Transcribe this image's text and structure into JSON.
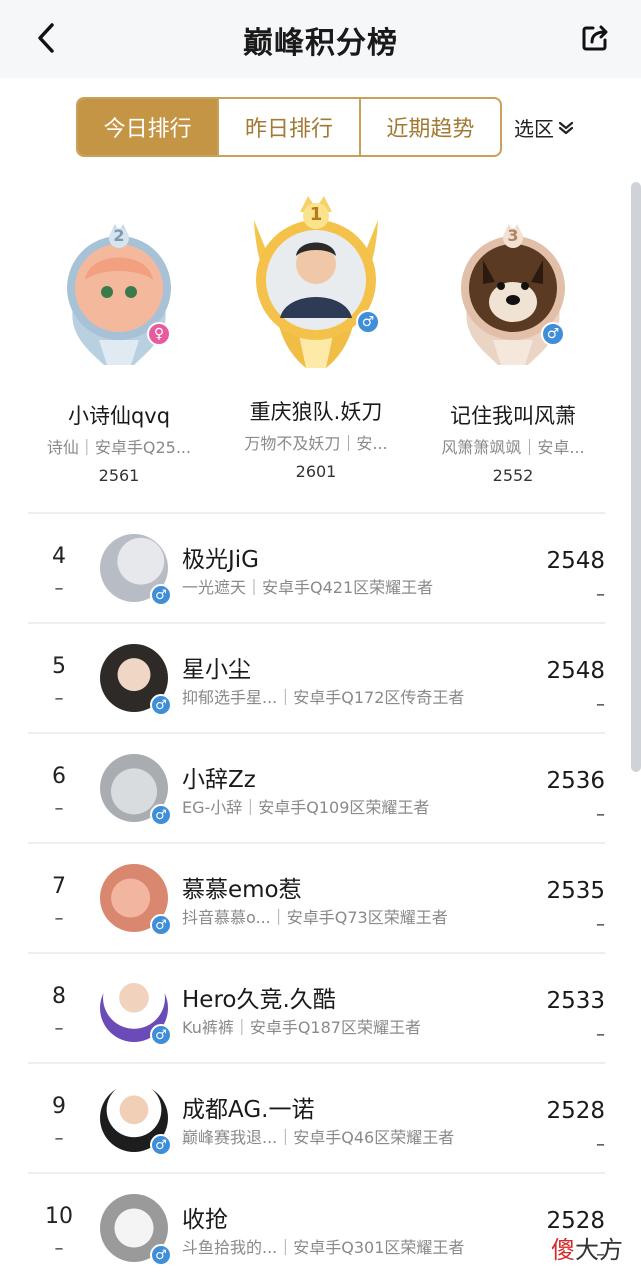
{
  "header": {
    "title": "巅峰积分榜",
    "back_icon": "chevron-left-icon",
    "share_icon": "share-icon"
  },
  "tabs": [
    {
      "label": "今日排行",
      "active": true
    },
    {
      "label": "昨日排行",
      "active": false
    },
    {
      "label": "近期趋势",
      "active": false
    }
  ],
  "region_filter": {
    "label": "选区",
    "icon": "chevron-down-double-icon"
  },
  "colors": {
    "gold": "#c49545",
    "blue": "#3f8ed8",
    "pink": "#e85aa0"
  },
  "podium": [
    {
      "rank": "2",
      "name": "小诗仙qvq",
      "sub": "诗仙｜安卓手Q25...",
      "score": "2561",
      "gender": "♀"
    },
    {
      "rank": "1",
      "name": "重庆狼队.妖刀",
      "sub": "万物不及妖刀｜安...",
      "score": "2601",
      "gender": "♂"
    },
    {
      "rank": "3",
      "name": "记住我叫风萧",
      "sub": "风箫箫飒飒｜安卓...",
      "score": "2552",
      "gender": "♂"
    }
  ],
  "list": [
    {
      "rank": "4",
      "trend": "–",
      "name": "极光JiG",
      "sub": "一光遮天｜安卓手Q421区荣耀王者",
      "score": "2548",
      "score_trend": "–",
      "gender": "♂"
    },
    {
      "rank": "5",
      "trend": "–",
      "name": "星小尘",
      "sub": "抑郁选手星...｜安卓手Q172区传奇王者",
      "score": "2548",
      "score_trend": "–",
      "gender": "♂"
    },
    {
      "rank": "6",
      "trend": "–",
      "name": "小辞Zz",
      "sub": "EG-小辞｜安卓手Q109区荣耀王者",
      "score": "2536",
      "score_trend": "–",
      "gender": "♂"
    },
    {
      "rank": "7",
      "trend": "–",
      "name": "慕慕emo惹",
      "sub": "抖音慕慕o...｜安卓手Q73区荣耀王者",
      "score": "2535",
      "score_trend": "–",
      "gender": "♂"
    },
    {
      "rank": "8",
      "trend": "–",
      "name": "Hero久竞.久酷",
      "sub": "Ku裤裤｜安卓手Q187区荣耀王者",
      "score": "2533",
      "score_trend": "–",
      "gender": "♂"
    },
    {
      "rank": "9",
      "trend": "–",
      "name": "成都AG.一诺",
      "sub": "巅峰赛我退...｜安卓手Q46区荣耀王者",
      "score": "2528",
      "score_trend": "–",
      "gender": "♂"
    },
    {
      "rank": "10",
      "trend": "–",
      "name": "收抢",
      "sub": "斗鱼拾我的...｜安卓手Q301区荣耀王者",
      "score": "2528",
      "score_trend": "–",
      "gender": "♂"
    }
  ],
  "watermark": {
    "first": "傻",
    "rest": "大方"
  }
}
